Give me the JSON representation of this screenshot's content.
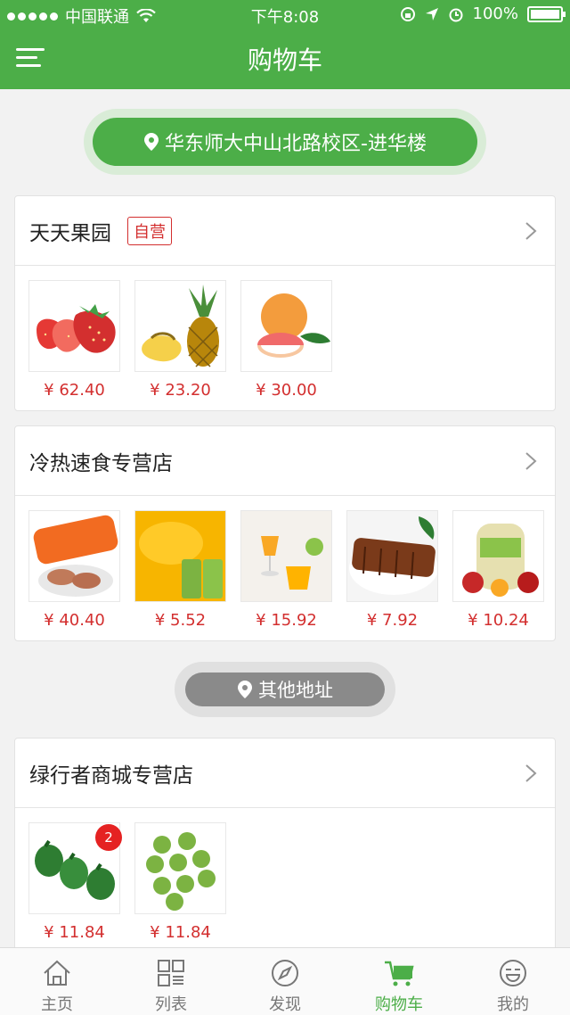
{
  "status_bar": {
    "carrier": "中国联通",
    "time": "下午8:08",
    "battery": "100%"
  },
  "nav": {
    "title": "购物车",
    "menu_icon": "hamburger-icon"
  },
  "location": {
    "address": "华东师大中山北路校区-进华楼",
    "icon": "location-pin-icon"
  },
  "other_address": {
    "label": "其他地址",
    "icon": "location-pin-icon"
  },
  "stores": [
    {
      "name": "天天果园",
      "tag": "自营",
      "items": [
        {
          "name": "strawberry",
          "price": "¥ 62.40"
        },
        {
          "name": "pineapple",
          "price": "¥ 23.20"
        },
        {
          "name": "grapefruit",
          "price": "¥ 30.00"
        }
      ]
    },
    {
      "name": "冷热速食专营店",
      "items": [
        {
          "name": "sausage",
          "price": "¥ 40.40"
        },
        {
          "name": "canned-peach",
          "price": "¥ 5.52"
        },
        {
          "name": "jelly-dessert",
          "price": "¥ 15.92"
        },
        {
          "name": "grilled-eel",
          "price": "¥ 7.92"
        },
        {
          "name": "fruit-jar",
          "price": "¥ 10.24"
        }
      ]
    },
    {
      "name": "绿行者商城专营店",
      "items": [
        {
          "name": "green-pepper",
          "price": "¥ 11.84",
          "badge": "2"
        },
        {
          "name": "green-tomato",
          "price": "¥ 11.84"
        }
      ]
    }
  ],
  "tabs": [
    {
      "label": "主页",
      "icon": "home-icon"
    },
    {
      "label": "列表",
      "icon": "grid-list-icon"
    },
    {
      "label": "发现",
      "icon": "compass-icon"
    },
    {
      "label": "购物车",
      "icon": "cart-icon",
      "active": true
    },
    {
      "label": "我的",
      "icon": "smiley-icon"
    }
  ],
  "colors": {
    "brand": "#4cae48",
    "price": "#d32f2f",
    "badge": "#e52222"
  }
}
